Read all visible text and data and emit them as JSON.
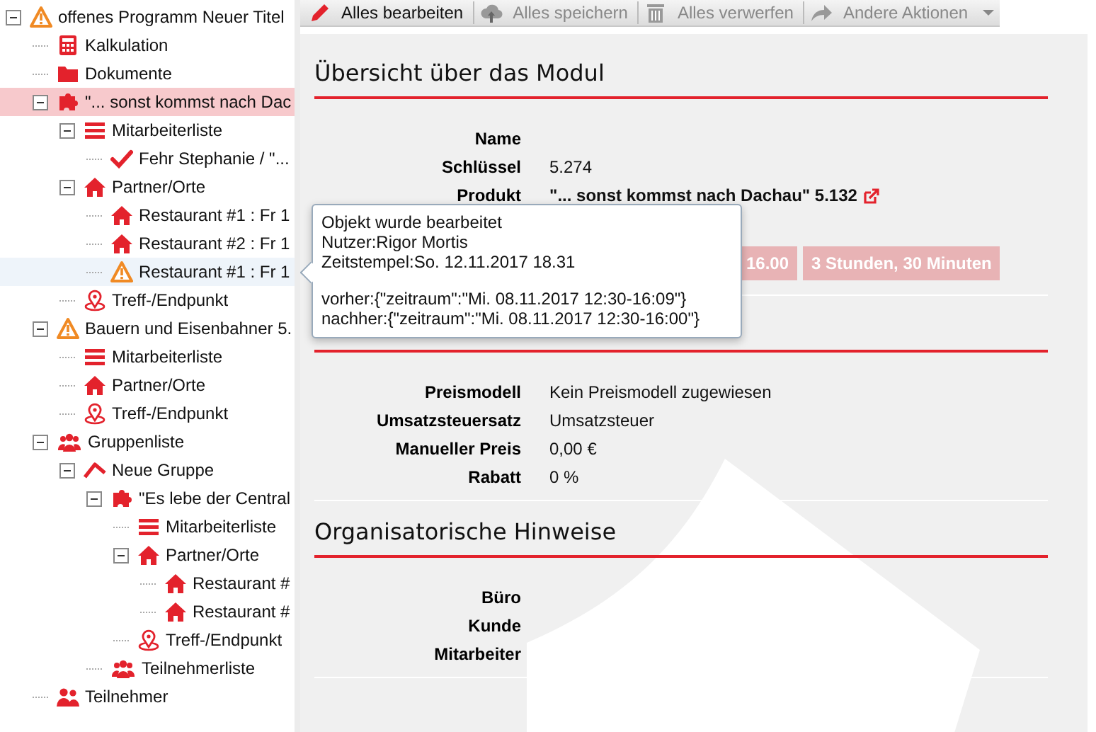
{
  "tree": [
    {
      "label": "offenes Programm Neuer Titel",
      "kind": "warning",
      "expanded": true,
      "selected": false,
      "hovered": false,
      "children": [
        {
          "label": "Kalkulation",
          "kind": "calculator",
          "selected": false,
          "hovered": false
        },
        {
          "label": "Dokumente",
          "kind": "folder",
          "selected": false,
          "hovered": false
        },
        {
          "label": "\"... sonst kommst nach Dac",
          "kind": "puzzle",
          "expanded": true,
          "selected": true,
          "hovered": false,
          "children": [
            {
              "label": "Mitarbeiterliste",
              "kind": "list",
              "expanded": true,
              "selected": false,
              "hovered": false,
              "children": [
                {
                  "label": "Fehr Stephanie / \"...",
                  "kind": "check",
                  "selected": false,
                  "hovered": false
                }
              ]
            },
            {
              "label": "Partner/Orte",
              "kind": "house",
              "expanded": true,
              "selected": false,
              "hovered": false,
              "children": [
                {
                  "label": "Restaurant #1 : Fr 1",
                  "kind": "house",
                  "selected": false,
                  "hovered": false
                },
                {
                  "label": "Restaurant #2 : Fr 1",
                  "kind": "house",
                  "selected": false,
                  "hovered": false
                },
                {
                  "label": "Restaurant #1 : Fr 1",
                  "kind": "warning",
                  "selected": false,
                  "hovered": true
                }
              ]
            },
            {
              "label": "Treff-/Endpunkt",
              "kind": "pin",
              "selected": false,
              "hovered": false
            }
          ]
        },
        {
          "label": "Bauern und Eisenbahner 5.",
          "kind": "warning",
          "expanded": true,
          "selected": false,
          "hovered": false,
          "children": [
            {
              "label": "Mitarbeiterliste",
              "kind": "list",
              "selected": false,
              "hovered": false
            },
            {
              "label": "Partner/Orte",
              "kind": "house",
              "selected": false,
              "hovered": false
            },
            {
              "label": "Treff-/Endpunkt",
              "kind": "pin",
              "selected": false,
              "hovered": false
            }
          ]
        },
        {
          "label": "Gruppenliste",
          "kind": "group",
          "expanded": true,
          "selected": false,
          "hovered": false,
          "children": [
            {
              "label": "Neue Gruppe",
              "kind": "roof",
              "expanded": true,
              "selected": false,
              "hovered": false,
              "children": [
                {
                  "label": "\"Es lebe der Central",
                  "kind": "puzzle",
                  "expanded": true,
                  "selected": false,
                  "hovered": false,
                  "children": [
                    {
                      "label": "Mitarbeiterliste",
                      "kind": "list",
                      "selected": false,
                      "hovered": false
                    },
                    {
                      "label": "Partner/Orte",
                      "kind": "house",
                      "expanded": true,
                      "selected": false,
                      "hovered": false,
                      "children": [
                        {
                          "label": "Restaurant #",
                          "kind": "house",
                          "selected": false,
                          "hovered": false
                        },
                        {
                          "label": "Restaurant #",
                          "kind": "house",
                          "selected": false,
                          "hovered": false
                        }
                      ]
                    },
                    {
                      "label": "Treff-/Endpunkt",
                      "kind": "pin",
                      "selected": false,
                      "hovered": false
                    }
                  ]
                },
                {
                  "label": "Teilnehmerliste",
                  "kind": "group",
                  "selected": false,
                  "hovered": false
                }
              ]
            }
          ]
        },
        {
          "label": "Teilnehmer",
          "kind": "people",
          "selected": false,
          "hovered": false
        }
      ]
    }
  ],
  "toolbar": [
    {
      "label": "Alles bearbeiten",
      "kind": "pencil",
      "disabled": false
    },
    {
      "label": "Alles speichern",
      "kind": "upload",
      "disabled": true
    },
    {
      "label": "Alles verwerfen",
      "kind": "trash",
      "disabled": true
    },
    {
      "label": "Andere Aktionen",
      "kind": "share",
      "disabled": true,
      "dropdown": true
    }
  ],
  "sections": [
    {
      "title": "Übersicht über das Modul",
      "rows": [
        {
          "label": "Name"
        },
        {
          "label": "Schlüssel",
          "value": "5.274"
        },
        {
          "label": "Produkt",
          "value": "\"... sonst kommst nach Dachau\" 5.132",
          "link": true
        },
        {
          "badges": [
            "16.00",
            "3 Stunden, 30 Minuten"
          ]
        }
      ]
    },
    {
      "rows": [
        {
          "label": "Preismodell",
          "value": "Kein Preismodell zugewiesen"
        },
        {
          "label": "Umsatzsteuersatz",
          "value": "Umsatzsteuer"
        },
        {
          "label": "Manueller Preis",
          "value": "0,00 €"
        },
        {
          "label": "Rabatt",
          "value": "0 %"
        }
      ]
    },
    {
      "title": "Organisatorische Hinweise",
      "rows": [
        {
          "label": "Büro"
        },
        {
          "label": "Kunde"
        },
        {
          "label": "Mitarbeiter"
        }
      ]
    }
  ],
  "tooltip": {
    "paragraphs": [
      [
        "Objekt wurde bearbeitet",
        "Nutzer:Rigor Mortis",
        "Zeitstempel:So. 12.11.2017 18.31"
      ],
      [
        "vorher:{\"zeitraum\":\"Mi. 08.11.2017 12:30-16:09\"}",
        "nachher:{\"zeitraum\":\"Mi. 08.11.2017 12:30-16:00\"}"
      ]
    ]
  }
}
